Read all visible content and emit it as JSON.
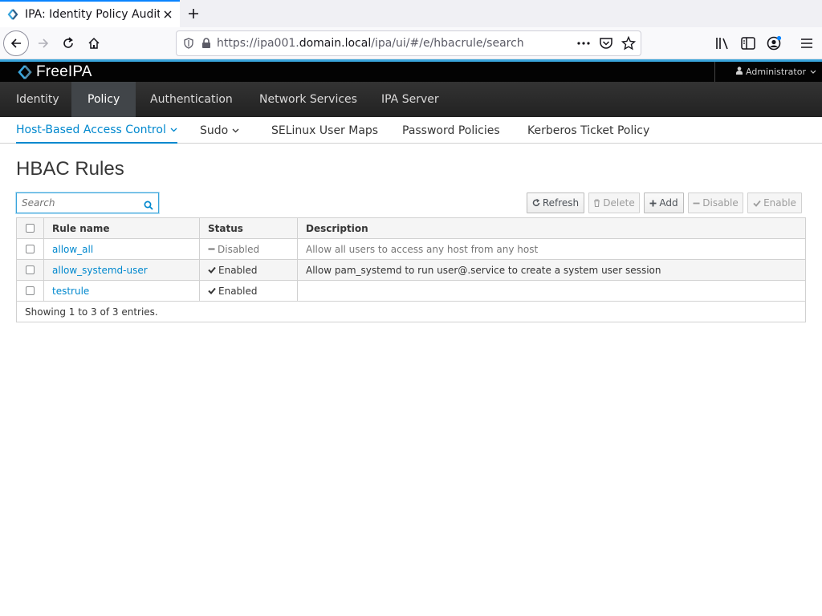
{
  "browser": {
    "tab_title": "IPA: Identity Policy Audit",
    "url_prefix": "https://ipa001.",
    "url_host": "domain.local",
    "url_path": "/ipa/ui/#/e/hbacrule/search"
  },
  "masthead": {
    "brand": "FreeIPA",
    "user": "Administrator"
  },
  "primary_nav": [
    {
      "label": "Identity",
      "active": false
    },
    {
      "label": "Policy",
      "active": true
    },
    {
      "label": "Authentication",
      "active": false
    },
    {
      "label": "Network Services",
      "active": false
    },
    {
      "label": "IPA Server",
      "active": false
    }
  ],
  "secondary_nav": [
    {
      "label": "Host-Based Access Control",
      "active": true,
      "dropdown": true
    },
    {
      "label": "Sudo",
      "active": false,
      "dropdown": true
    },
    {
      "label": "SELinux User Maps",
      "active": false,
      "dropdown": false
    },
    {
      "label": "Password Policies",
      "active": false,
      "dropdown": false
    },
    {
      "label": "Kerberos Ticket Policy",
      "active": false,
      "dropdown": false
    }
  ],
  "page": {
    "title": "HBAC Rules",
    "search_placeholder": "Search"
  },
  "toolbar": {
    "refresh": "Refresh",
    "delete": "Delete",
    "add": "Add",
    "disable": "Disable",
    "enable": "Enable"
  },
  "table": {
    "columns": [
      "Rule name",
      "Status",
      "Description"
    ],
    "rows": [
      {
        "name": "allow_all",
        "status": "Disabled",
        "description": "Allow all users to access any host from any host"
      },
      {
        "name": "allow_systemd-user",
        "status": "Enabled",
        "description": "Allow pam_systemd to run user@.service to create a system user session"
      },
      {
        "name": "testrule",
        "status": "Enabled",
        "description": ""
      }
    ],
    "footer": "Showing 1 to 3 of 3 entries."
  },
  "colors": {
    "accent": "#39a5dc",
    "link": "#0088ce",
    "masthead": "#030303",
    "primary_nav": "#292e34"
  }
}
